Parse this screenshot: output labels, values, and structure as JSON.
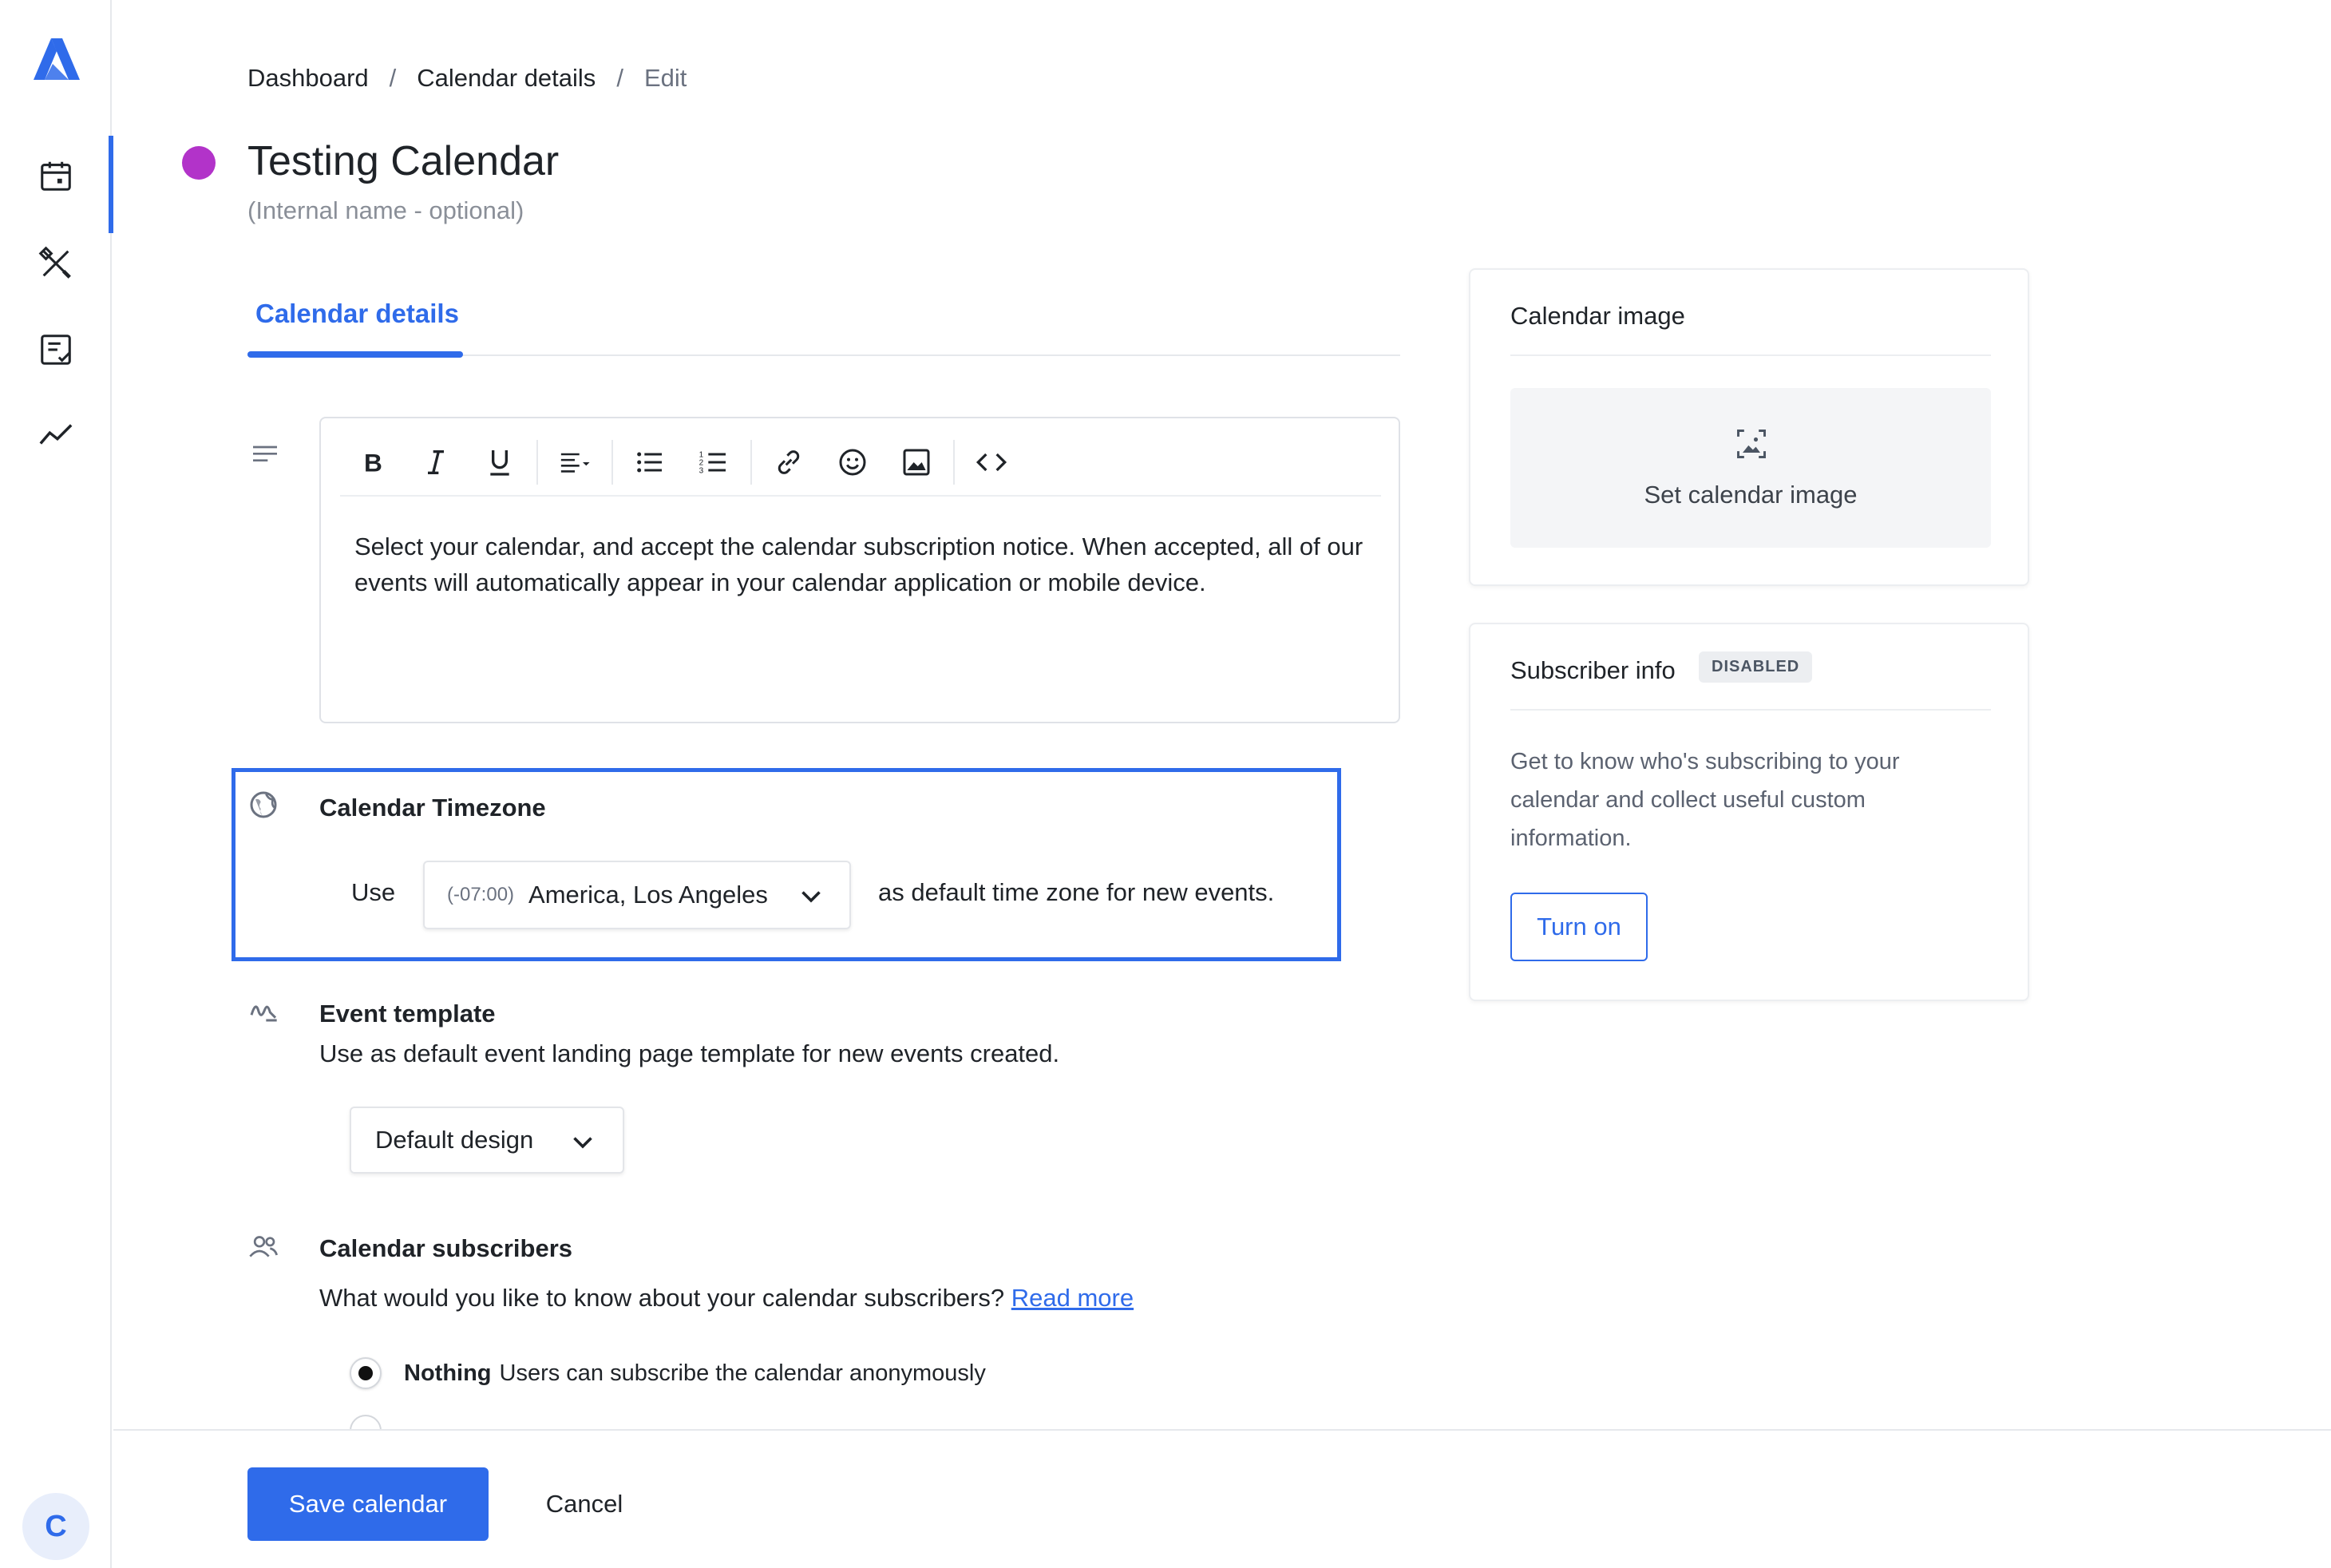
{
  "breadcrumb": {
    "items": [
      "Dashboard",
      "Calendar details",
      "Edit"
    ],
    "separator": "/"
  },
  "calendar": {
    "title": "Testing Calendar",
    "internal_name_placeholder": "(Internal name - optional)",
    "color": "#b233c9"
  },
  "tabs": [
    {
      "label": "Calendar details",
      "active": true
    }
  ],
  "editor": {
    "toolbar": [
      "bold-icon",
      "italic-icon",
      "underline-icon",
      "align-icon",
      "bullet-list-icon",
      "numbered-list-icon",
      "link-icon",
      "emoji-icon",
      "image-icon",
      "code-icon"
    ],
    "content": "Select your calendar, and accept the calendar subscription notice. When accepted, all of our events will automatically appear in your calendar application or mobile device."
  },
  "timezone": {
    "title": "Calendar Timezone",
    "use_label": "Use",
    "offset": "(-07:00)",
    "value": "America, Los Angeles",
    "after_text": "as default time zone for new events."
  },
  "event_template": {
    "title": "Event template",
    "description": "Use as default event landing page template for new events created.",
    "selected": "Default design"
  },
  "subscribers": {
    "title": "Calendar subscribers",
    "description": "What would you like to know about your calendar subscribers?",
    "read_more": "Read more",
    "options": [
      {
        "bold": "Nothing",
        "text": "Users can subscribe the calendar anonymously",
        "selected": true
      }
    ]
  },
  "footer": {
    "save_label": "Save calendar",
    "cancel_label": "Cancel"
  },
  "calendar_image_card": {
    "title": "Calendar image",
    "set_label": "Set calendar image"
  },
  "subscriber_info_card": {
    "title": "Subscriber info",
    "badge": "DISABLED",
    "body": "Get to know who's subscribing to your calendar and collect useful custom information.",
    "button_label": "Turn on"
  },
  "user": {
    "avatar_initial": "C"
  },
  "colors": {
    "accent": "#2f6bea",
    "calendar_dot": "#b233c9"
  }
}
